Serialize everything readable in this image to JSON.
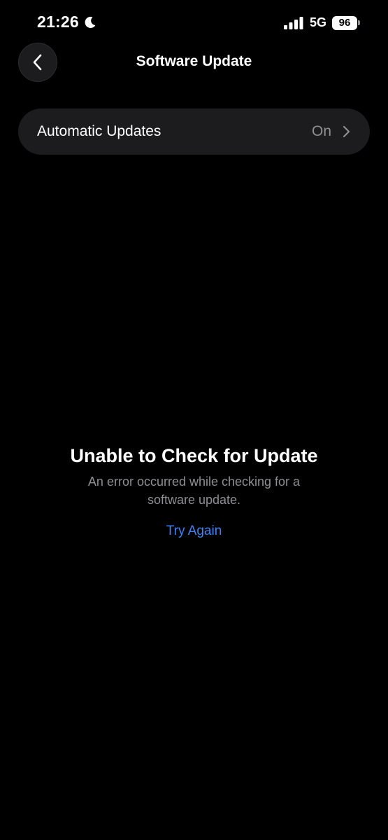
{
  "status_bar": {
    "time": "21:26",
    "focus_icon": "moon-icon",
    "signal_icon": "cellular-signal-icon",
    "network": "5G",
    "battery_level": "96"
  },
  "nav": {
    "back_icon": "chevron-left-icon",
    "title": "Software Update"
  },
  "settings": {
    "automatic_updates": {
      "label": "Automatic Updates",
      "value": "On",
      "icon": "chevron-right-icon"
    }
  },
  "error": {
    "title": "Unable to Check for Update",
    "message": "An error occurred while checking for a software update.",
    "action_label": "Try Again"
  },
  "colors": {
    "background": "#000000",
    "row_background": "#1c1c1e",
    "secondary_text": "#8e8e93",
    "accent": "#3b82f6"
  }
}
